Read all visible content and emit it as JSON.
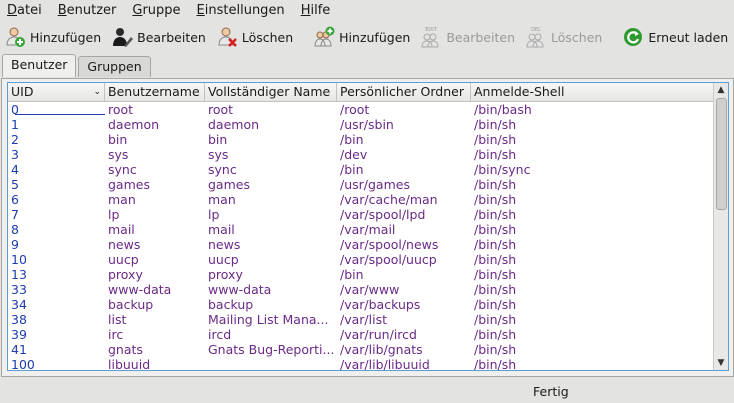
{
  "menu": [
    {
      "pre": "",
      "u": "D",
      "post": "atei"
    },
    {
      "pre": "",
      "u": "B",
      "post": "enutzer"
    },
    {
      "pre": "",
      "u": "G",
      "post": "ruppe"
    },
    {
      "pre": "",
      "u": "E",
      "post": "instellungen"
    },
    {
      "pre": "",
      "u": "H",
      "post": "ilfe"
    }
  ],
  "toolbar": {
    "user_add": "Hinzufügen",
    "user_edit": "Bearbeiten",
    "user_delete": "Löschen",
    "group_add": "Hinzufügen",
    "group_edit": "Bearbeiten",
    "group_delete": "Löschen",
    "reload": "Erneut laden",
    "icon_edit_text": "EDIT",
    "icon_del_text": "DEL"
  },
  "tabs": [
    {
      "label": "Benutzer",
      "active": true
    },
    {
      "label": "Gruppen",
      "active": false
    }
  ],
  "table": {
    "columns": [
      "UID",
      "Benutzername",
      "Vollständiger Name",
      "Persönlicher Ordner",
      "Anmelde-Shell"
    ],
    "sort_indicator": "⌄",
    "rows": [
      [
        "0",
        "root",
        "root",
        "/root",
        "/bin/bash"
      ],
      [
        "1",
        "daemon",
        "daemon",
        "/usr/sbin",
        "/bin/sh"
      ],
      [
        "2",
        "bin",
        "bin",
        "/bin",
        "/bin/sh"
      ],
      [
        "3",
        "sys",
        "sys",
        "/dev",
        "/bin/sh"
      ],
      [
        "4",
        "sync",
        "sync",
        "/bin",
        "/bin/sync"
      ],
      [
        "5",
        "games",
        "games",
        "/usr/games",
        "/bin/sh"
      ],
      [
        "6",
        "man",
        "man",
        "/var/cache/man",
        "/bin/sh"
      ],
      [
        "7",
        "lp",
        "lp",
        "/var/spool/lpd",
        "/bin/sh"
      ],
      [
        "8",
        "mail",
        "mail",
        "/var/mail",
        "/bin/sh"
      ],
      [
        "9",
        "news",
        "news",
        "/var/spool/news",
        "/bin/sh"
      ],
      [
        "10",
        "uucp",
        "uucp",
        "/var/spool/uucp",
        "/bin/sh"
      ],
      [
        "13",
        "proxy",
        "proxy",
        "/bin",
        "/bin/sh"
      ],
      [
        "33",
        "www-data",
        "www-data",
        "/var/www",
        "/bin/sh"
      ],
      [
        "34",
        "backup",
        "backup",
        "/var/backups",
        "/bin/sh"
      ],
      [
        "38",
        "list",
        "Mailing List Mana...",
        "/var/list",
        "/bin/sh"
      ],
      [
        "39",
        "irc",
        "ircd",
        "/var/run/ircd",
        "/bin/sh"
      ],
      [
        "41",
        "gnats",
        "Gnats Bug-Reporti...",
        "/var/lib/gnats",
        "/bin/sh"
      ],
      [
        "100",
        "libuuid",
        "",
        "/var/lib/libuuid",
        "/bin/sh"
      ]
    ]
  },
  "status": "Fertig",
  "colors": {
    "accent": "#5d9ed4",
    "uid": "#1f3cb0",
    "name": "#6a2a87"
  }
}
